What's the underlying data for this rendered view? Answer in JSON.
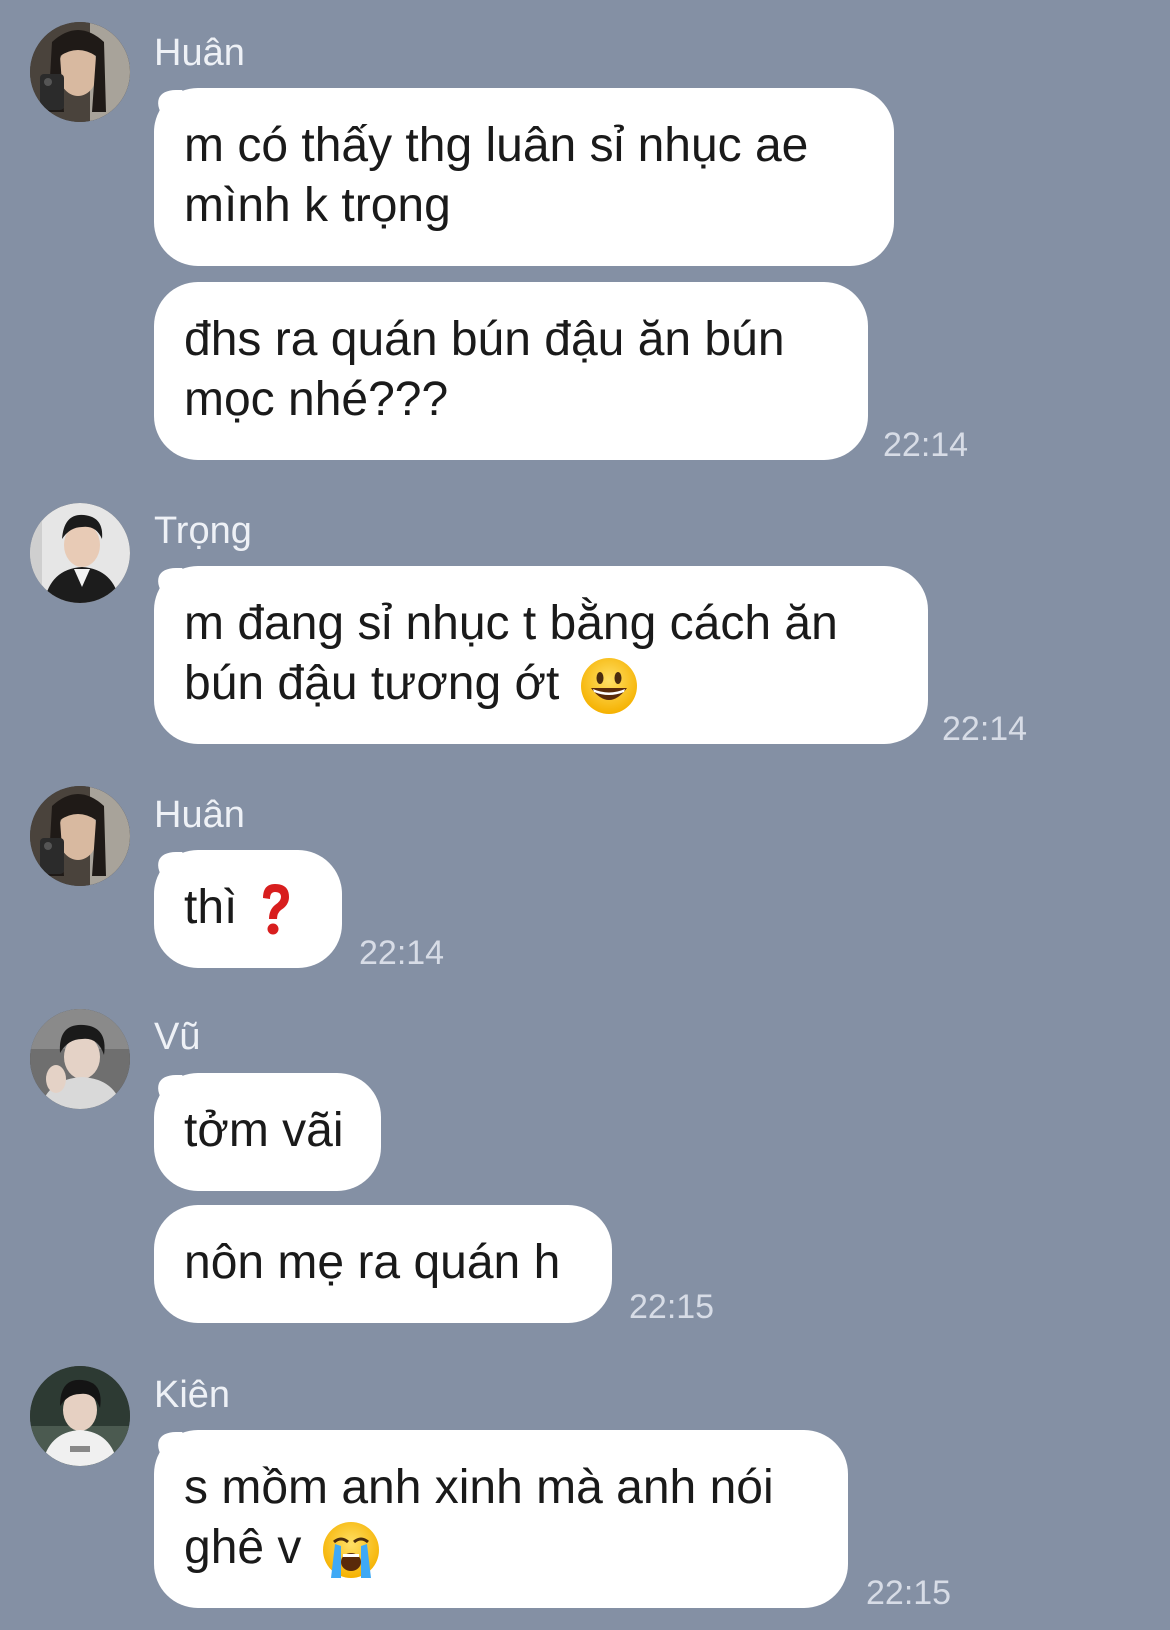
{
  "colors": {
    "background": "#8490a4",
    "bubble": "#ffffff",
    "message_text": "#1a1a1a",
    "sender_name": "#eef1f6",
    "timestamp": "#d7dce6"
  },
  "groups": [
    {
      "sender": "Huân",
      "avatar": "avatar-huan",
      "time": "22:14",
      "messages": [
        {
          "lines": [
            "m có thấy thg luân sỉ nhục ae",
            "mình k trọng"
          ]
        },
        {
          "lines": [
            "đhs ra quán bún đậu ăn bún",
            "mọc nhé???"
          ]
        }
      ]
    },
    {
      "sender": "Trọng",
      "avatar": "avatar-trong",
      "time": "22:14",
      "messages": [
        {
          "lines": [
            "m đang sỉ nhục t bằng cách ăn",
            "bún đậu tương ớt"
          ],
          "trailing_icon": "grinning-face-emoji-icon"
        }
      ]
    },
    {
      "sender": "Huân",
      "avatar": "avatar-huan",
      "time": "22:14",
      "messages": [
        {
          "lines": [
            "thì"
          ],
          "trailing_icon": "red-question-mark-emoji-icon"
        }
      ]
    },
    {
      "sender": "Vũ",
      "avatar": "avatar-vu",
      "time": "22:15",
      "messages": [
        {
          "lines": [
            "tởm vãi"
          ]
        },
        {
          "lines": [
            "nôn mẹ ra quán h"
          ]
        }
      ]
    },
    {
      "sender": "Kiên",
      "avatar": "avatar-kien",
      "time": "22:15",
      "messages": [
        {
          "lines": [
            "s mồm anh xinh mà anh nói",
            "ghê v"
          ],
          "trailing_icon": "loudly-crying-face-emoji-icon"
        }
      ]
    }
  ]
}
